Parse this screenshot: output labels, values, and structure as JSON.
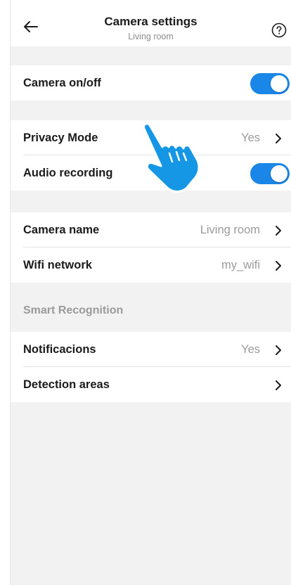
{
  "header": {
    "title": "Camera settings",
    "subtitle": "Living room",
    "back_icon": "arrow-left-icon",
    "help_icon": "question-circle-icon"
  },
  "general": {
    "camera_onoff": {
      "label": "Camera on/off",
      "enabled": true
    }
  },
  "privacy": {
    "privacy_mode": {
      "label": "Privacy Mode",
      "value": "Yes"
    },
    "audio_recording": {
      "label": "Audio recording",
      "enabled": true
    }
  },
  "device": {
    "camera_name": {
      "label": "Camera name",
      "value": "Living room"
    },
    "wifi_network": {
      "label": "Wifi network",
      "value": "my_wifi"
    }
  },
  "smart_recognition": {
    "title": "Smart Recognition",
    "notifications": {
      "label": "Notificacions",
      "value": "Yes"
    },
    "detection_areas": {
      "label": "Detection areas"
    }
  },
  "colors": {
    "accent": "#1a86e8",
    "background": "#f2f2f2",
    "muted_text": "#9a9a9a"
  },
  "overlay": {
    "pointer": "hand-pointer-icon"
  }
}
